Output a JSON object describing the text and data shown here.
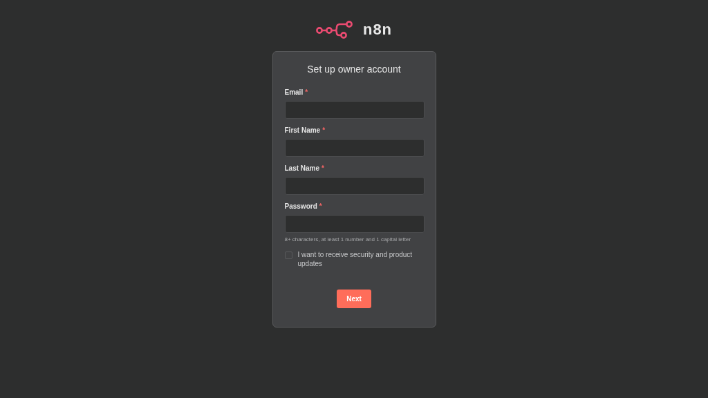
{
  "logo": {
    "text": "n8n"
  },
  "card": {
    "title": "Set up owner account",
    "fields": [
      {
        "label": "Email",
        "required_mark": "*"
      },
      {
        "label": "First Name",
        "required_mark": "*"
      },
      {
        "label": "Last Name",
        "required_mark": "*"
      },
      {
        "label": "Password",
        "required_mark": "*",
        "hint": "8+ characters, at least 1 number and 1 capital letter"
      }
    ],
    "checkbox": {
      "label": "I want to receive security and product updates",
      "checked": false
    },
    "button": "Next"
  }
}
